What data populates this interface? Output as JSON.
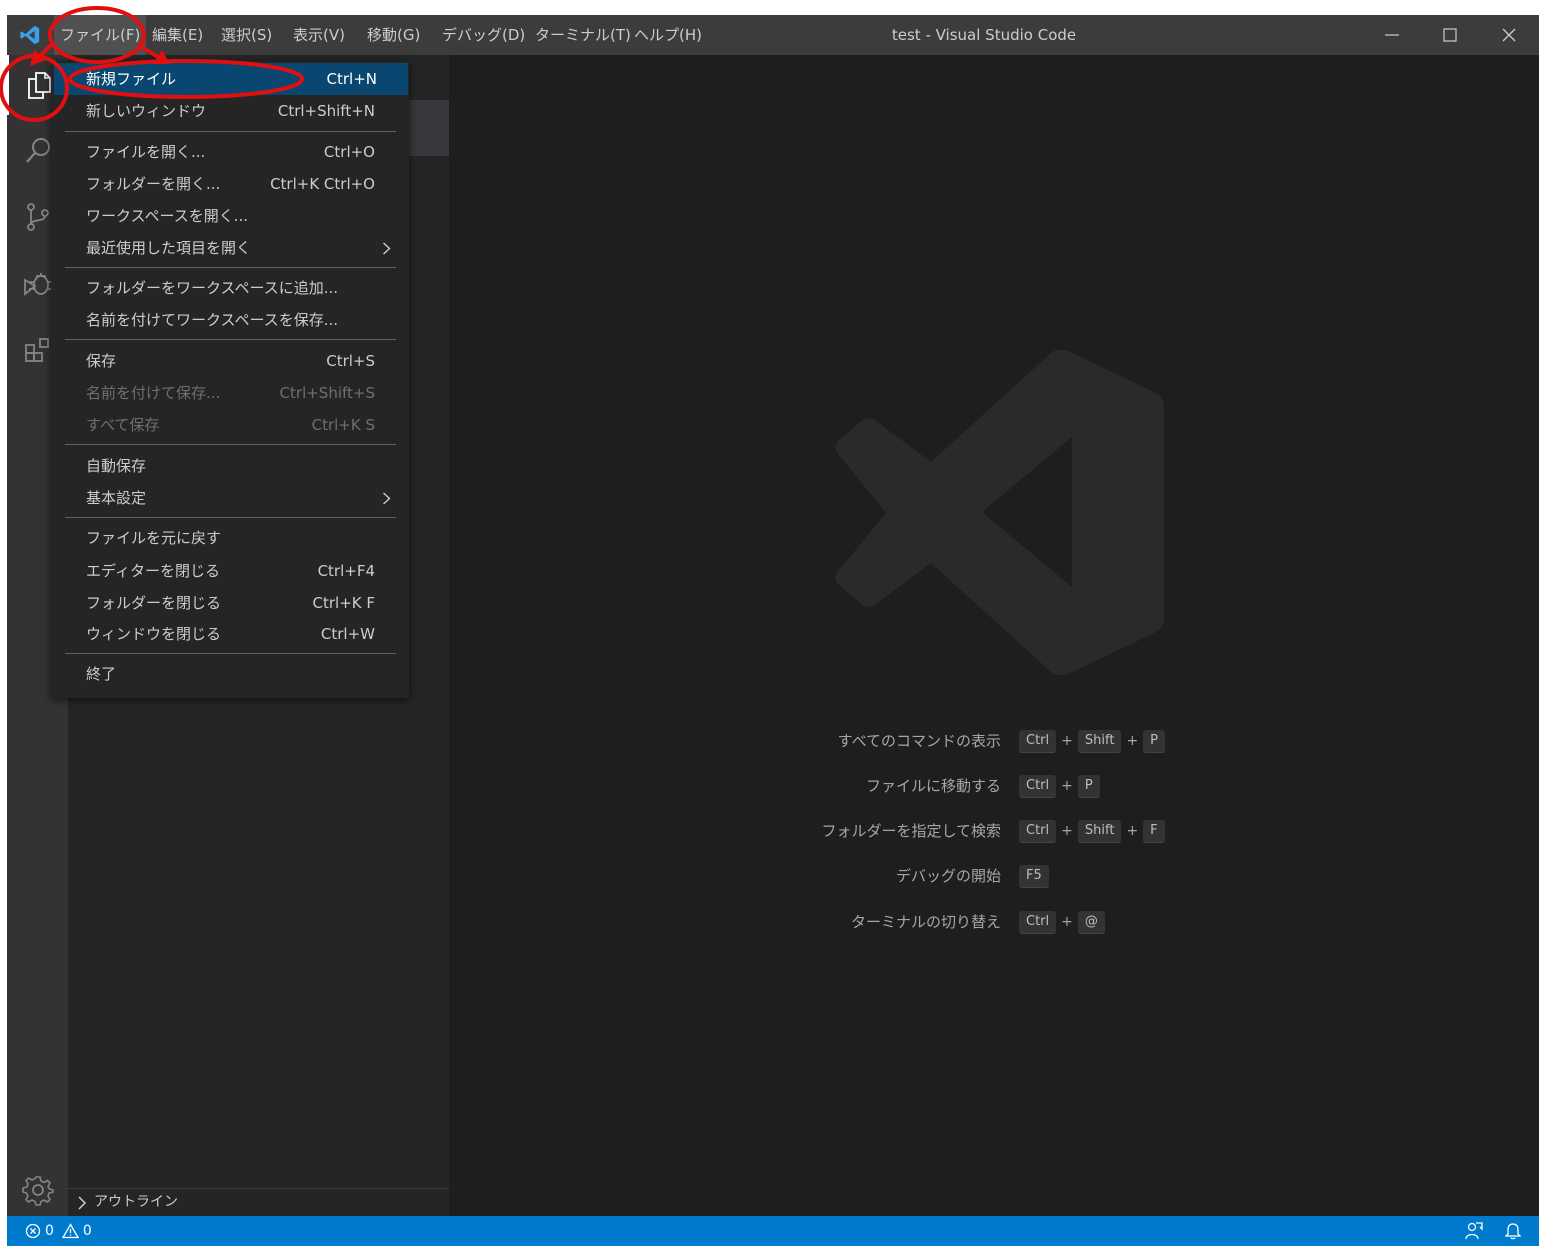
{
  "window": {
    "title": "test - Visual Studio Code",
    "logo_icon": "vscode-logo-icon",
    "controls": [
      "minimize-icon",
      "maximize-icon",
      "close-icon"
    ]
  },
  "menubar": {
    "items": [
      {
        "label": "ファイル(F)",
        "active": true
      },
      {
        "label": "編集(E)"
      },
      {
        "label": "選択(S)"
      },
      {
        "label": "表示(V)"
      },
      {
        "label": "移動(G)"
      },
      {
        "label": "デバッグ(D)"
      },
      {
        "label": "ターミナル(T)"
      },
      {
        "label": "ヘルプ(H)"
      }
    ]
  },
  "activity_bar": {
    "items": [
      "explorer-icon",
      "search-icon",
      "source-control-icon",
      "debug-icon",
      "extensions-icon"
    ],
    "bottom": "settings-gear-icon"
  },
  "sidebar": {
    "outline_label": "アウトライン"
  },
  "file_menu": {
    "items": [
      {
        "label": "新規ファイル",
        "shortcut": "Ctrl+N",
        "selected": true
      },
      {
        "label": "新しいウィンドウ",
        "shortcut": "Ctrl+Shift+N"
      },
      {
        "label": "ファイルを開く...",
        "shortcut": "Ctrl+O"
      },
      {
        "label": "フォルダーを開く...",
        "shortcut": "Ctrl+K Ctrl+O"
      },
      {
        "label": "ワークスペースを開く...",
        "shortcut": ""
      },
      {
        "label": "最近使用した項目を開く",
        "shortcut": "",
        "submenu": true
      },
      {
        "label": "フォルダーをワークスペースに追加...",
        "shortcut": ""
      },
      {
        "label": "名前を付けてワークスペースを保存...",
        "shortcut": ""
      },
      {
        "label": "保存",
        "shortcut": "Ctrl+S"
      },
      {
        "label": "名前を付けて保存...",
        "shortcut": "Ctrl+Shift+S",
        "disabled": true
      },
      {
        "label": "すべて保存",
        "shortcut": "Ctrl+K S",
        "disabled": true
      },
      {
        "label": "自動保存",
        "shortcut": ""
      },
      {
        "label": "基本設定",
        "shortcut": "",
        "submenu": true
      },
      {
        "label": "ファイルを元に戻す",
        "shortcut": ""
      },
      {
        "label": "エディターを閉じる",
        "shortcut": "Ctrl+F4"
      },
      {
        "label": "フォルダーを閉じる",
        "shortcut": "Ctrl+K F"
      },
      {
        "label": "ウィンドウを閉じる",
        "shortcut": "Ctrl+W"
      },
      {
        "label": "終了",
        "shortcut": ""
      }
    ]
  },
  "welcome_shortcuts": [
    {
      "label": "すべてのコマンドの表示",
      "keys": [
        "Ctrl",
        "Shift",
        "P"
      ]
    },
    {
      "label": "ファイルに移動する",
      "keys": [
        "Ctrl",
        "P"
      ]
    },
    {
      "label": "フォルダーを指定して検索",
      "keys": [
        "Ctrl",
        "Shift",
        "F"
      ]
    },
    {
      "label": "デバッグの開始",
      "keys": [
        "F5"
      ]
    },
    {
      "label": "ターミナルの切り替え",
      "keys": [
        "Ctrl",
        "@"
      ]
    }
  ],
  "status_bar": {
    "errors": "0",
    "warnings": "0",
    "right_icons": [
      "feedback-icon",
      "notifications-bell-icon"
    ]
  },
  "colors": {
    "status_bar": "#007acc",
    "menu_selection": "#094771",
    "annotation": "#e01010"
  }
}
